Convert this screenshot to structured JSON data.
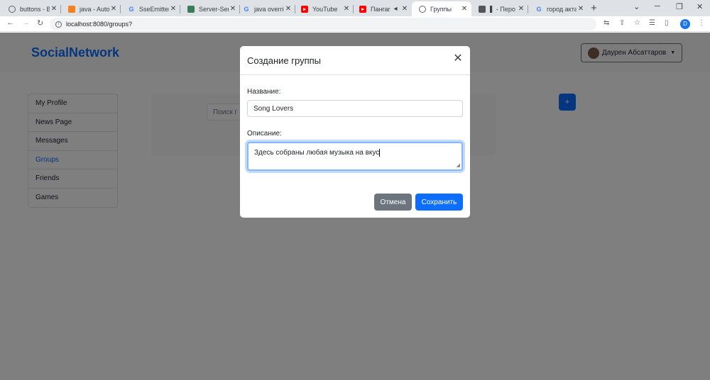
{
  "tabs": [
    {
      "title": "buttons - Bo",
      "icon": "globe-icon",
      "color": "#5f6368"
    },
    {
      "title": "java - Autow",
      "icon": "stackoverflow-icon",
      "color": "#f48024"
    },
    {
      "title": "SseEmitter",
      "icon": "google-icon",
      "color": "#4285f4"
    },
    {
      "title": "Server-Sent",
      "icon": "image-icon",
      "color": "#3c7a5a"
    },
    {
      "title": "java overrid",
      "icon": "google-icon",
      "color": "#4285f4"
    },
    {
      "title": "YouTube",
      "icon": "youtube-icon",
      "color": "#ff0000"
    },
    {
      "title": "Пангаг",
      "icon": "youtube-icon",
      "color": "#ff0000"
    },
    {
      "title": "Группы",
      "icon": "globe-icon",
      "color": "#5f6368"
    },
    {
      "title": "▌ - Перо",
      "icon": "app-icon",
      "color": "#555"
    },
    {
      "title": "город акта",
      "icon": "google-icon",
      "color": "#4285f4"
    }
  ],
  "address": {
    "url": "localhost:8080/groups?"
  },
  "profile_initial": "D",
  "navbar": {
    "brand": "SocialNetwork",
    "user": "Даурен Абсаттаров"
  },
  "sidebar": {
    "items": [
      "My Profile",
      "News Page",
      "Messages",
      "Groups",
      "Friends",
      "Games"
    ],
    "active": "Groups"
  },
  "search": {
    "placeholder": "Поиск г"
  },
  "add_button": "+",
  "modal": {
    "title": "Создание группы",
    "name_label": "Название:",
    "name_value": "Song Lovers",
    "desc_label": "Описание:",
    "desc_value": "Здесь собраны любая музыка на вкус",
    "cancel": "Отмена",
    "save": "Сохранить"
  }
}
